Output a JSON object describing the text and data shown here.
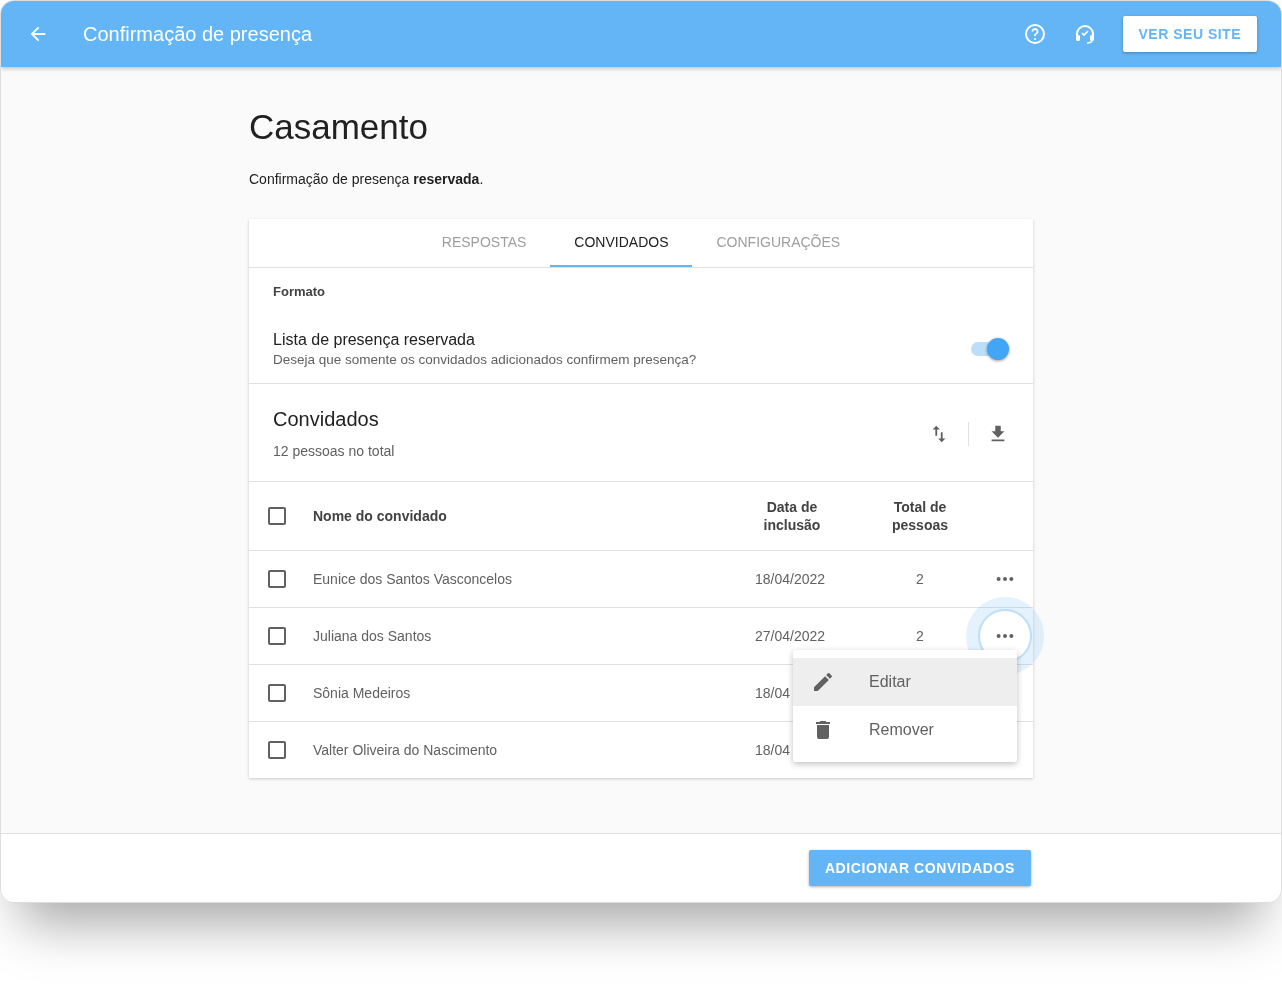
{
  "app_bar": {
    "title": "Confirmação de presença",
    "site_button": "VER SEU SITE"
  },
  "page": {
    "title": "Casamento",
    "subtitle": "Confirmação de presença **reservada**."
  },
  "tabs": [
    {
      "label": "RESPOSTAS",
      "selected": false
    },
    {
      "label": "CONVIDADOS",
      "selected": true
    },
    {
      "label": "CONFIGURAÇÕES",
      "selected": false
    }
  ],
  "format": {
    "label": "Formato",
    "setting": {
      "title": "Lista de presença reservada",
      "description": "Deseja que somente os convidados adicionados confirmem presença?",
      "on": true
    }
  },
  "guests": {
    "title": "Convidados",
    "count": "12 pessoas no total",
    "columns": [
      "Nome do convidado",
      "Data de inclusão",
      "Total de pessoas"
    ],
    "header_checked": false,
    "rows": [
      {
        "name": "Eunice dos Santos Vasconcelos",
        "date": "18/04/2022",
        "total": "2",
        "checked": false,
        "menu_open": false
      },
      {
        "name": "Juliana dos Santos",
        "date": "27/04/2022",
        "total": "2",
        "checked": false,
        "menu_open": true
      },
      {
        "name": "Sônia Medeiros",
        "date": "18/04",
        "checked": false
      },
      {
        "name": "Valter Oliveira do Nascimento",
        "date": "18/04",
        "checked": false
      }
    ],
    "menu": [
      {
        "kind": "edit",
        "label": "Editar",
        "highlighted": true
      },
      {
        "kind": "remove",
        "label": "Remover",
        "highlighted": false
      }
    ]
  },
  "footer": {
    "button": "ADICIONAR CONVIDADOS"
  }
}
